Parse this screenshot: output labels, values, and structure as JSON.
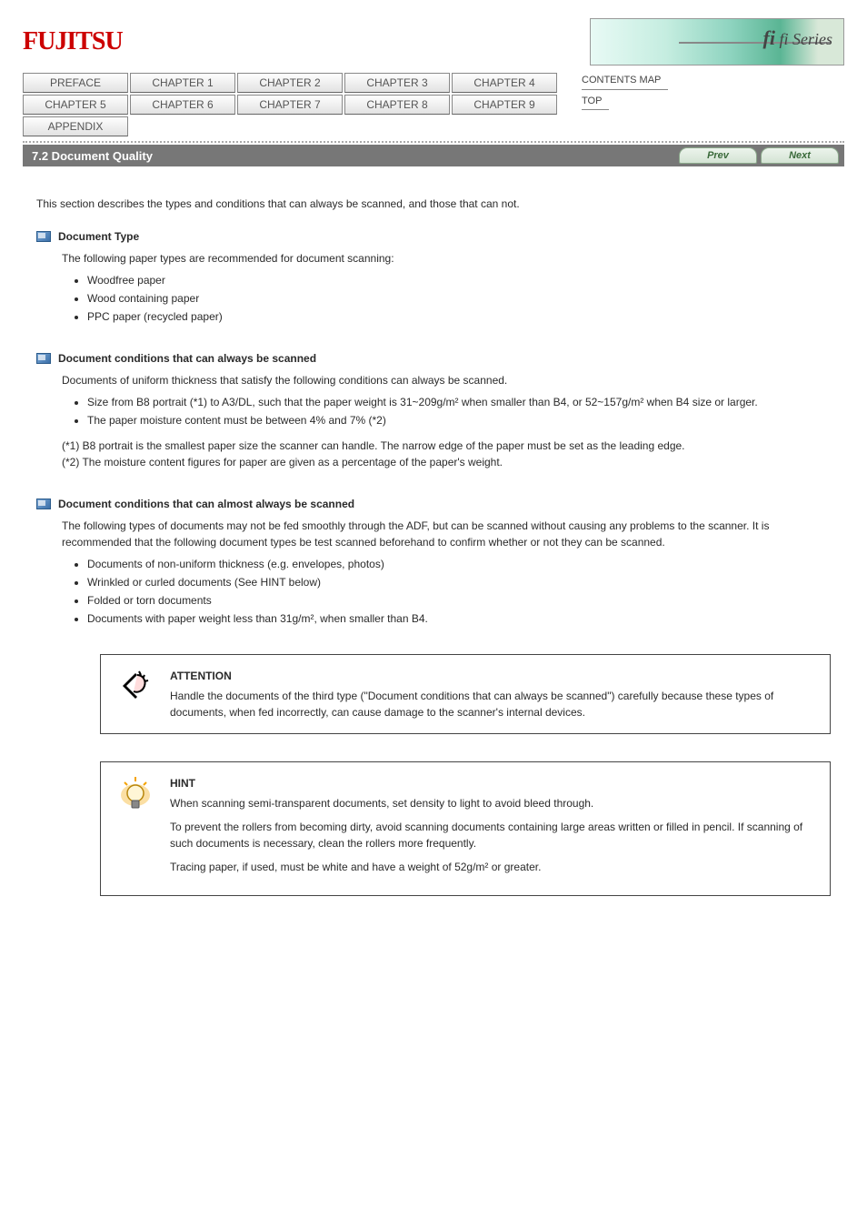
{
  "header": {
    "logo_text": "FUJITSU",
    "banner_label": "fi Series"
  },
  "tabs": {
    "items": [
      "PREFACE",
      "CHAPTER 1",
      "CHAPTER 2",
      "CHAPTER 3",
      "CHAPTER 4",
      "CHAPTER 5",
      "CHAPTER 6",
      "CHAPTER 7",
      "CHAPTER 8",
      "CHAPTER 9",
      "APPENDIX"
    ]
  },
  "sidelinks": {
    "line0": "CONTENTS MAP",
    "line1": "TOP"
  },
  "sectionbar": {
    "title": "7.2 Document Quality",
    "prev_label": "Prev",
    "next_label": "Next"
  },
  "content": {
    "intro": "This section describes the types and conditions that can always be scanned, and those that can not.",
    "groups": [
      {
        "title": "Document Type",
        "desc": "The following paper types are recommended for document scanning:",
        "items": [
          "Woodfree paper",
          "Wood containing paper",
          "PPC paper (recycled paper)"
        ]
      },
      {
        "title": "Document conditions that can always be scanned",
        "desc": "Documents of uniform thickness that satisfy the following conditions can always be scanned.",
        "items": [
          "Size from B8 portrait (*1) to A3/DL, such that the paper weight is 31~209g/m² when smaller than B4, or 52~157g/m² when B4 size or larger.",
          "The paper moisture content must be between 4% and 7% (*2)"
        ],
        "footnotes": [
          "(*1) B8 portrait is the smallest paper size the scanner can handle. The narrow edge of the paper must be set as the leading edge.",
          "(*2) The moisture content figures for paper are given as a percentage of the paper's weight."
        ]
      },
      {
        "title": "Document conditions that can almost always be scanned",
        "desc": "The following types of documents may not be fed smoothly through the ADF, but can be scanned without causing any problems to the scanner. It is recommended that the following document types be test scanned beforehand to confirm whether or not they can be scanned.",
        "items": [
          "Documents of non-uniform thickness (e.g. envelopes, photos)",
          "Wrinkled or curled documents (See HINT below)",
          "Folded or torn documents",
          "Documents with paper weight less than 31g/m², when smaller than B4."
        ]
      }
    ],
    "attention": {
      "label": "ATTENTION",
      "text": "Handle the documents of the third type (\"Document conditions that can always be scanned\") carefully because these types of documents, when fed incorrectly, can cause damage to the scanner's internal devices."
    },
    "hint": {
      "label": "HINT",
      "lines": [
        "When scanning semi-transparent documents, set density to light to avoid bleed through.",
        "To prevent the rollers from becoming dirty, avoid scanning documents containing large areas written or filled in pencil. If scanning of such documents is necessary, clean the rollers more frequently.",
        "Tracing paper, if used, must be white and have a weight of 52g/m² or greater."
      ]
    }
  }
}
